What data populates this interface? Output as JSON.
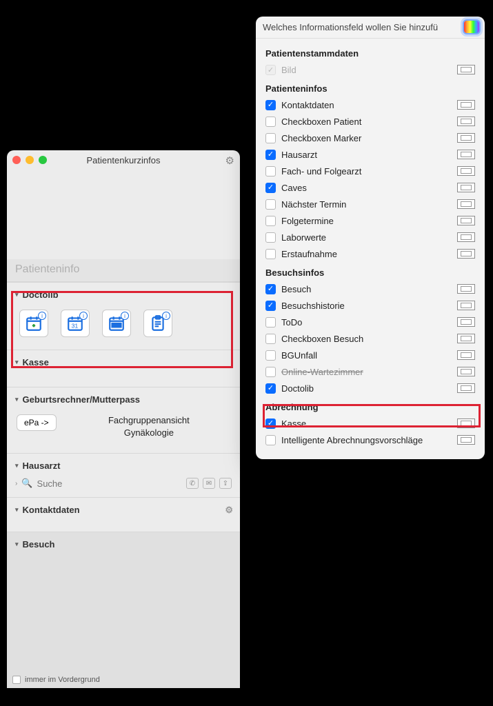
{
  "left": {
    "title": "Patientenkurzinfos",
    "patinfo": "Patienteninfo",
    "sections": {
      "doctolib": "Doctolib",
      "kasse": "Kasse",
      "geburt": "Geburtsrechner/Mutterpass",
      "hausarzt": "Hausarzt",
      "kontakt": "Kontaktdaten",
      "besuch": "Besuch"
    },
    "epa_btn": "ePa ->",
    "fach_line1": "Fachgruppenansicht",
    "fach_line2": "Gynäkologie",
    "search_placeholder": "Suche",
    "footer": "immer im Vordergrund"
  },
  "right": {
    "head": "Welches Informationsfeld wollen Sie hinzufü",
    "groups": [
      {
        "title": "Patientenstammdaten",
        "items": [
          {
            "label": "Bild",
            "checked": true,
            "dim": true
          }
        ]
      },
      {
        "title": "Patienteninfos",
        "items": [
          {
            "label": "Kontaktdaten",
            "checked": true
          },
          {
            "label": "Checkboxen Patient",
            "checked": false
          },
          {
            "label": "Checkboxen Marker",
            "checked": false
          },
          {
            "label": "Hausarzt",
            "checked": true
          },
          {
            "label": "Fach- und Folgearzt",
            "checked": false
          },
          {
            "label": "Caves",
            "checked": true
          },
          {
            "label": "Nächster Termin",
            "checked": false
          },
          {
            "label": "Folgetermine",
            "checked": false
          },
          {
            "label": "Laborwerte",
            "checked": false
          },
          {
            "label": "Erstaufnahme",
            "checked": false
          }
        ]
      },
      {
        "title": "Besuchsinfos",
        "items": [
          {
            "label": "Besuch",
            "checked": true
          },
          {
            "label": "Besuchshistorie",
            "checked": true
          },
          {
            "label": "ToDo",
            "checked": false
          },
          {
            "label": "Checkboxen Besuch",
            "checked": false
          },
          {
            "label": "BGUnfall",
            "checked": false
          },
          {
            "label": "Online-Wartezimmer",
            "checked": false,
            "strike": true
          },
          {
            "label": "Doctolib",
            "checked": true
          }
        ]
      },
      {
        "title": "Abrechnung",
        "items": [
          {
            "label": "Kasse",
            "checked": true
          },
          {
            "label": "Intelligente Abrechnungsvorschläge",
            "checked": false
          }
        ]
      }
    ]
  }
}
